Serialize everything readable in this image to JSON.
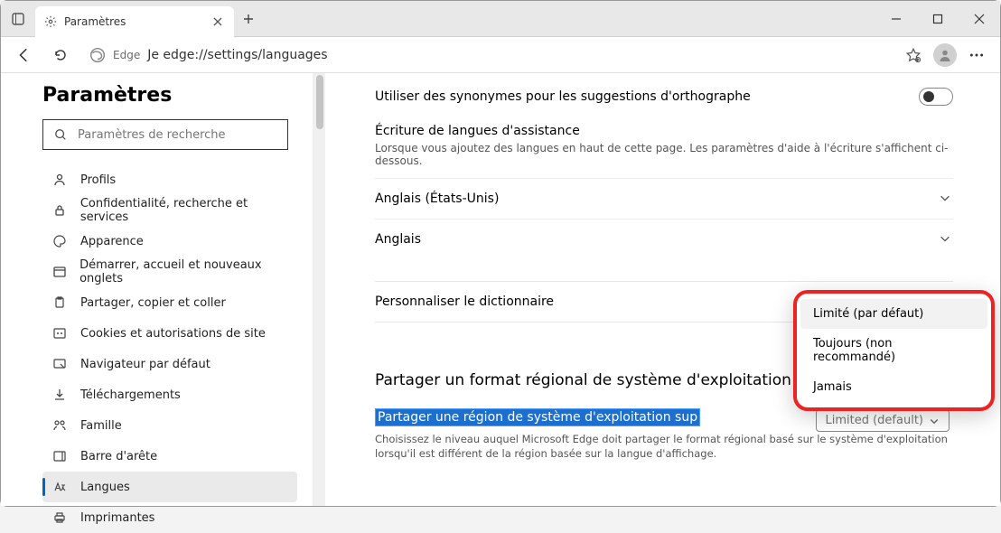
{
  "tab": {
    "title": "Paramètres"
  },
  "address": {
    "prefix": "Edge",
    "url_prefix": "Je ",
    "url": "edge://settings/languages"
  },
  "settings_title": "Paramètres",
  "search": {
    "placeholder": "Paramètres de recherche"
  },
  "sidebar": {
    "items": [
      {
        "label": "Profils"
      },
      {
        "label": "Confidentialité, recherche et services"
      },
      {
        "label": "Apparence"
      },
      {
        "label": "Démarrer, accueil et nouveaux onglets"
      },
      {
        "label": "Partager, copier et coller"
      },
      {
        "label": "Cookies et autorisations de site"
      },
      {
        "label": "Navigateur par défaut"
      },
      {
        "label": "Téléchargements"
      },
      {
        "label": "Famille"
      },
      {
        "label": "Barre d'arête"
      },
      {
        "label": "Langues"
      },
      {
        "label": "Imprimantes"
      }
    ]
  },
  "content": {
    "synonym_label": "Utiliser des synonymes pour les suggestions d'orthographe",
    "assist_heading": "Écriture de langues d'assistance",
    "assist_desc": "Lorsque vous ajoutez des langues en haut de cette page. Les paramètres d'aide à l'écriture s'affichent ci-dessous.",
    "lang_en_us": "Anglais (États-Unis)",
    "lang_en": "Anglais",
    "dict_link": "Personnaliser le dictionnaire",
    "region_heading": "Partager un format régional de système d'exploitation supplémentaire",
    "region_highlight": "Partager une région de système d'exploitation sup",
    "region_desc": "Choisissez le niveau auquel Microsoft Edge doit partager le format régional basé sur le système d'exploitation lorsqu'il est différent de la région basée sur la langue d'affichage.",
    "dropdown_selected": "Limited (default)"
  },
  "popup": {
    "items": [
      {
        "label": "Limité (par défaut)"
      },
      {
        "label": "Toujours (non recommandé)"
      },
      {
        "label": "Jamais"
      }
    ]
  }
}
